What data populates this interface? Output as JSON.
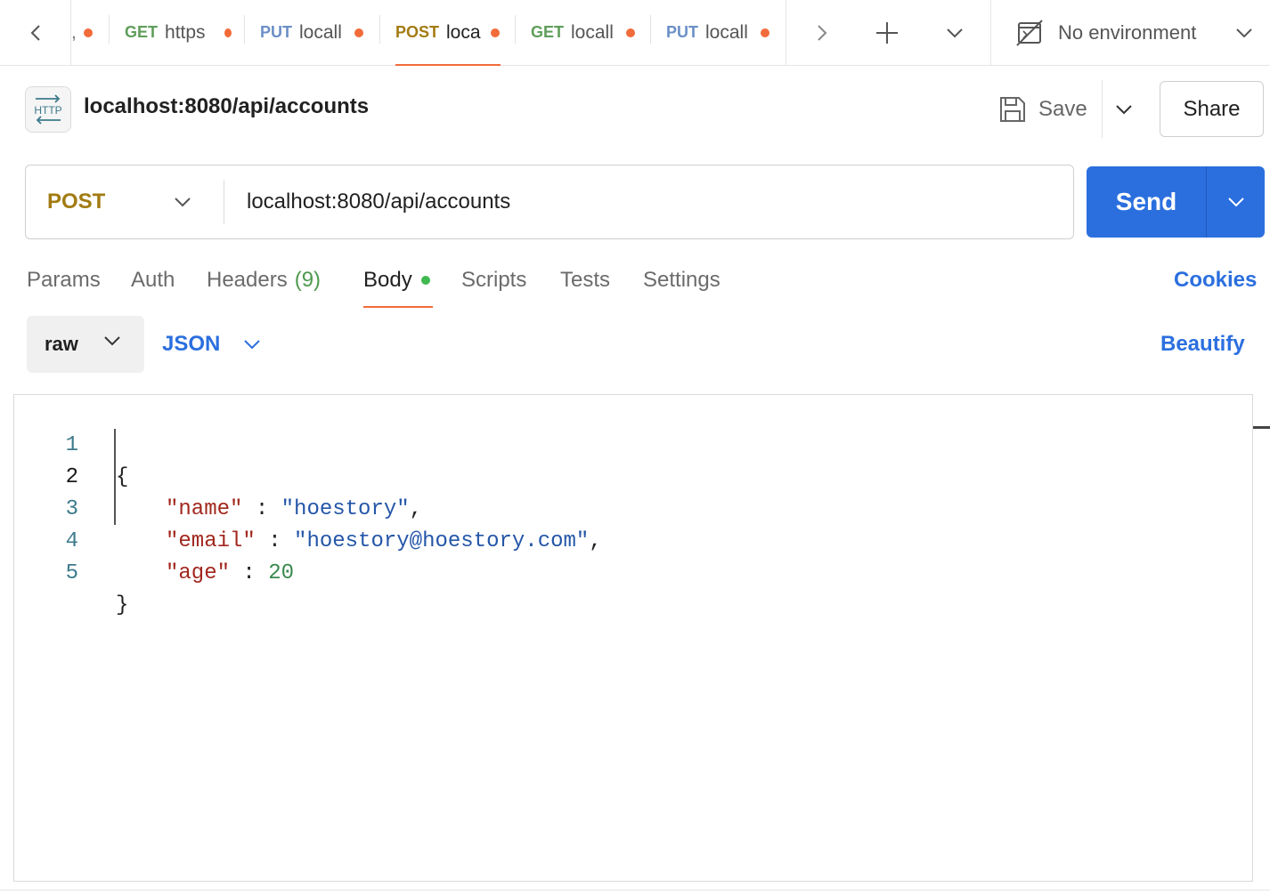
{
  "tabs": [
    {
      "method": "",
      "title": ",",
      "dirty": true
    },
    {
      "method": "GET",
      "title": "https",
      "dirty": true
    },
    {
      "method": "PUT",
      "title": "locall",
      "dirty": true
    },
    {
      "method": "POST",
      "title": "loca",
      "dirty": true,
      "active": true
    },
    {
      "method": "GET",
      "title": "locall",
      "dirty": true
    },
    {
      "method": "PUT",
      "title": "locall",
      "dirty": true
    }
  ],
  "environment": {
    "label": "No environment"
  },
  "request": {
    "badge": "HTTP",
    "title": "localhost:8080/api/accounts",
    "save_label": "Save",
    "share_label": "Share",
    "method": "POST",
    "url": "localhost:8080/api/accounts",
    "send_label": "Send"
  },
  "subtabs": {
    "params": "Params",
    "auth": "Auth",
    "headers": "Headers",
    "headers_count": "(9)",
    "body": "Body",
    "scripts": "Scripts",
    "tests": "Tests",
    "settings": "Settings",
    "cookies": "Cookies",
    "active": "Body"
  },
  "body_options": {
    "mode": "raw",
    "language": "JSON",
    "beautify": "Beautify"
  },
  "editor": {
    "current_line": 2,
    "lines": [
      {
        "n": "1",
        "key": "",
        "sep": "",
        "value": "",
        "open": "{",
        "trail": ""
      },
      {
        "n": "2",
        "key": "\"name\"",
        "sep": " : ",
        "value": "\"hoestory\"",
        "trail": ","
      },
      {
        "n": "3",
        "key": "\"email\"",
        "sep": " : ",
        "value": "\"hoestory@hoestory.com\"",
        "trail": ","
      },
      {
        "n": "4",
        "key": "\"age\"",
        "sep": " : ",
        "value": "20",
        "trail": ""
      },
      {
        "n": "5",
        "close": "}"
      }
    ]
  },
  "colors": {
    "accent_orange": "#f26b3a",
    "send_blue": "#2b6fdf",
    "post_method": "#a27b12",
    "get_method": "#5f9e5a",
    "put_method": "#6b8fc7"
  }
}
